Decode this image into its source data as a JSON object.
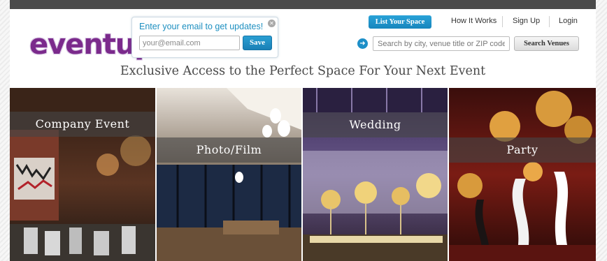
{
  "brand": {
    "logo_text": "eventup",
    "logo_color": "#7b2a8c"
  },
  "email_signup": {
    "heading": "Enter your email to get updates!",
    "placeholder": "your@email.com",
    "save_label": "Save",
    "close_icon": "close-icon"
  },
  "nav": {
    "list_space_label": "List Your Space",
    "links": [
      "How It Works",
      "Sign Up",
      "Login"
    ]
  },
  "search": {
    "placeholder": "Search by city, venue title or ZIP code",
    "button_label": "Search Venues",
    "arrow_icon": "arrow-right-circle-icon"
  },
  "tagline": "Exclusive Access to the Perfect Space For Your Next Event",
  "categories": [
    {
      "label": "Company Event"
    },
    {
      "label": "Photo/Film"
    },
    {
      "label": "Wedding"
    },
    {
      "label": "Party"
    }
  ],
  "colors": {
    "accent_blue": "#1d8fc8",
    "top_bar": "#4a4a4a",
    "label_band": "rgba(70,70,70,0.62)"
  }
}
